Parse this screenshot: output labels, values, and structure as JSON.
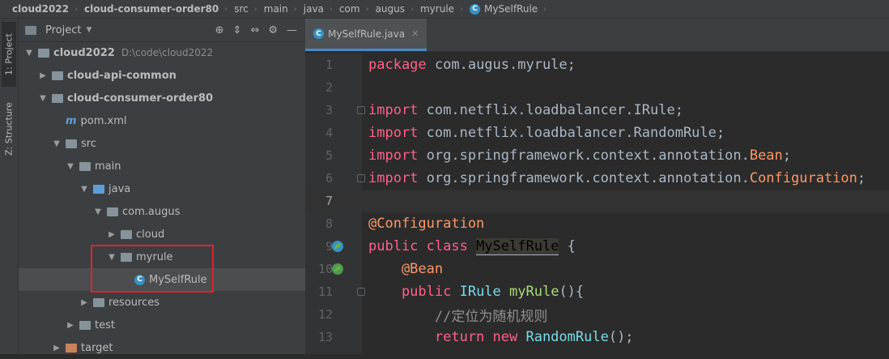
{
  "breadcrumb": [
    "cloud2022",
    "cloud-consumer-order80",
    "src",
    "main",
    "java",
    "com",
    "augus",
    "myrule",
    "MySelfRule"
  ],
  "left_strip": {
    "project_tab": "1: Project",
    "structure_tab": "Z: Structure"
  },
  "project_panel": {
    "title": "Project",
    "tree": [
      {
        "label": "cloud2022",
        "extra": "D:\\code\\cloud2022",
        "indent": 0,
        "arrow": "▼",
        "icon": "folder",
        "bold": true
      },
      {
        "label": "cloud-api-common",
        "indent": 1,
        "arrow": "▶",
        "icon": "folder",
        "bold": true
      },
      {
        "label": "cloud-consumer-order80",
        "indent": 1,
        "arrow": "▼",
        "icon": "folder",
        "bold": true
      },
      {
        "label": "pom.xml",
        "indent": 2,
        "arrow": "",
        "icon": "maven",
        "bold": false
      },
      {
        "label": "src",
        "indent": 2,
        "arrow": "▼",
        "icon": "folder",
        "bold": false
      },
      {
        "label": "main",
        "indent": 3,
        "arrow": "▼",
        "icon": "folder",
        "bold": false
      },
      {
        "label": "java",
        "indent": 4,
        "arrow": "▼",
        "icon": "folder-blue",
        "bold": false
      },
      {
        "label": "com.augus",
        "indent": 5,
        "arrow": "▼",
        "icon": "package",
        "bold": false
      },
      {
        "label": "cloud",
        "indent": 6,
        "arrow": "▶",
        "icon": "package",
        "bold": false
      },
      {
        "label": "myrule",
        "indent": 6,
        "arrow": "▼",
        "icon": "package",
        "bold": false
      },
      {
        "label": "MySelfRule",
        "indent": 7,
        "arrow": "",
        "icon": "class",
        "bold": false,
        "selected": true
      },
      {
        "label": "resources",
        "indent": 4,
        "arrow": "▶",
        "icon": "folder-res",
        "bold": false
      },
      {
        "label": "test",
        "indent": 3,
        "arrow": "▶",
        "icon": "folder",
        "bold": false
      },
      {
        "label": "target",
        "indent": 2,
        "arrow": "▶",
        "icon": "folder-orange",
        "bold": false
      }
    ]
  },
  "editor": {
    "tab_label": "MySelfRule.java",
    "lines": [
      {
        "n": "1",
        "parts": [
          [
            "kw",
            "package"
          ],
          [
            "txt",
            " com.augus.myrule;"
          ]
        ]
      },
      {
        "n": "2",
        "parts": []
      },
      {
        "n": "3",
        "parts": [
          [
            "kw",
            "import"
          ],
          [
            "txt",
            " com.netflix.loadbalancer.IRule;"
          ]
        ],
        "fold": true
      },
      {
        "n": "4",
        "parts": [
          [
            "kw",
            "import"
          ],
          [
            "txt",
            " com.netflix.loadbalancer.RandomRule;"
          ]
        ]
      },
      {
        "n": "5",
        "parts": [
          [
            "kw",
            "import"
          ],
          [
            "txt",
            " org.springframework.context.annotation."
          ],
          [
            "ann",
            "Bean"
          ],
          [
            "txt",
            ";"
          ]
        ]
      },
      {
        "n": "6",
        "parts": [
          [
            "kw",
            "import"
          ],
          [
            "txt",
            " org.springframework.context.annotation."
          ],
          [
            "ann",
            "Configuration"
          ],
          [
            "txt",
            ";"
          ]
        ],
        "fold": true
      },
      {
        "n": "7",
        "parts": [],
        "current": true
      },
      {
        "n": "8",
        "parts": [
          [
            "ann",
            "@Configuration"
          ]
        ]
      },
      {
        "n": "9",
        "parts": [
          [
            "kw",
            "public class "
          ],
          [
            "hl",
            "MySelfRule"
          ],
          [
            "txt",
            " {"
          ]
        ],
        "gicon": "class"
      },
      {
        "n": "10",
        "parts": [
          [
            "ann",
            "    @Bean"
          ]
        ],
        "gicon": "bean"
      },
      {
        "n": "11",
        "parts": [
          [
            "kw",
            "    public "
          ],
          [
            "type",
            "IRule "
          ],
          [
            "fn",
            "myRule"
          ],
          [
            "txt",
            "(){"
          ]
        ],
        "fold": true
      },
      {
        "n": "12",
        "parts": [
          [
            "cmt",
            "        //定位为随机规则"
          ]
        ]
      },
      {
        "n": "13",
        "parts": [
          [
            "kw",
            "        return new "
          ],
          [
            "type",
            "RandomRule"
          ],
          [
            "txt",
            "();"
          ]
        ]
      }
    ]
  }
}
